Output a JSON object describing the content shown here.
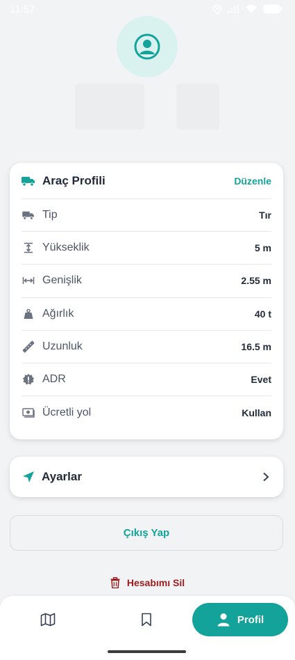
{
  "status_bar": {
    "time": "11:57"
  },
  "colors": {
    "accent": "#14a39a",
    "danger": "#9b1c1c",
    "background": "#f2f3f5"
  },
  "vehicle_profile": {
    "title": "Araç Profili",
    "edit_label": "Düzenle",
    "specs": [
      {
        "icon": "truck-icon",
        "label": "Tip",
        "value": "Tır"
      },
      {
        "icon": "height-icon",
        "label": "Yükseklik",
        "value": "5 m"
      },
      {
        "icon": "width-icon",
        "label": "Genişlik",
        "value": "2.55 m"
      },
      {
        "icon": "weight-icon",
        "label": "Ağırlık",
        "value": "40 t"
      },
      {
        "icon": "ruler-icon",
        "label": "Uzunluk",
        "value": "16.5 m"
      },
      {
        "icon": "hazard-icon",
        "label": "ADR",
        "value": "Evet"
      },
      {
        "icon": "toll-icon",
        "label": "Ücretli yol",
        "value": "Kullan"
      }
    ]
  },
  "settings": {
    "label": "Ayarlar"
  },
  "logout": {
    "label": "Çıkış Yap"
  },
  "delete_account": {
    "label": "Hesabımı Sil"
  },
  "bottom_nav": {
    "items": [
      {
        "icon": "map-icon",
        "label": ""
      },
      {
        "icon": "bookmark-icon",
        "label": ""
      },
      {
        "icon": "person-icon",
        "label": "Profil",
        "active": true
      }
    ]
  }
}
